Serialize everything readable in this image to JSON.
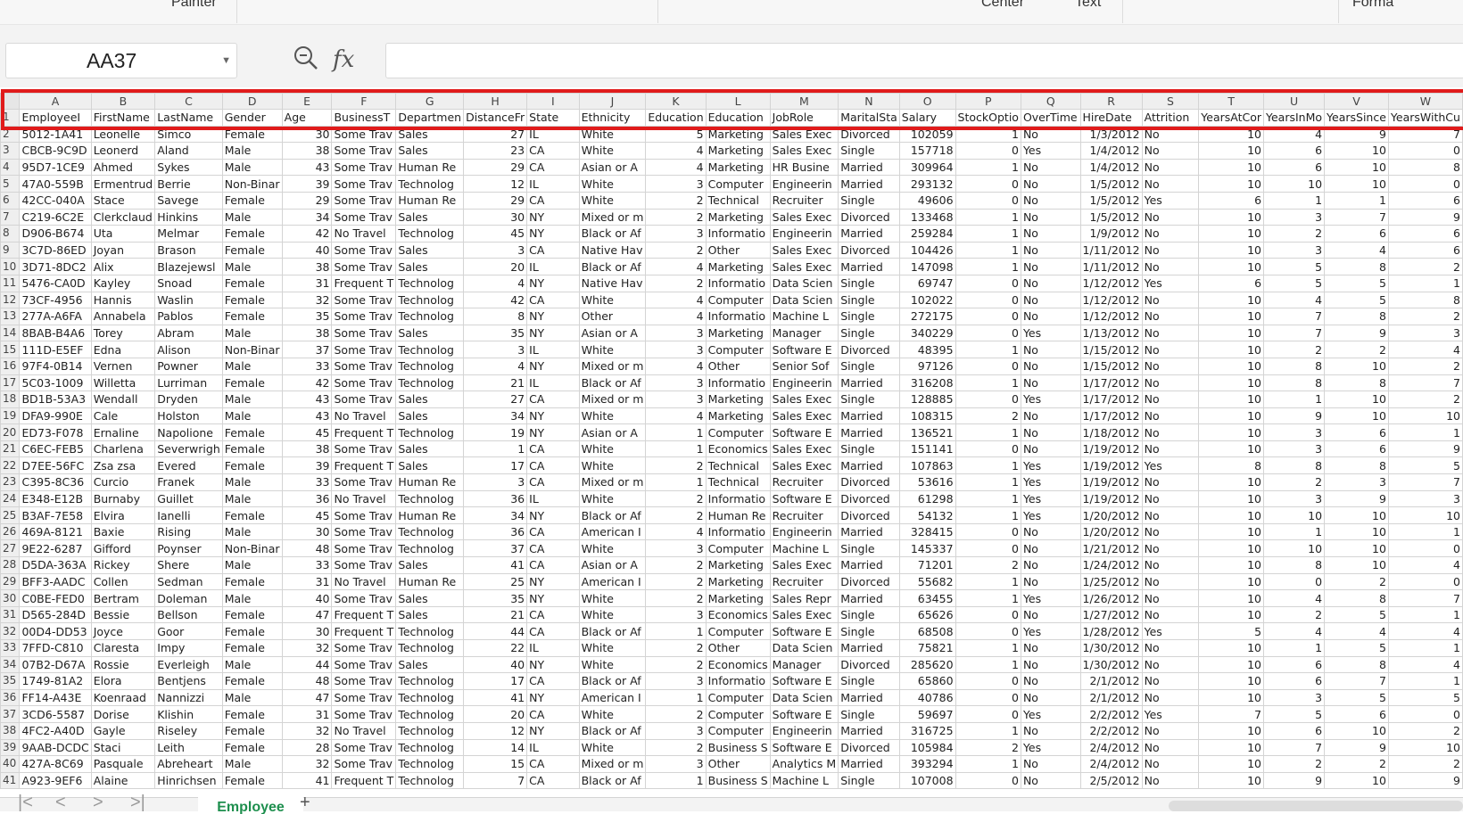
{
  "ribbon": {
    "frag_painter": "Painter",
    "frag_center": "Center",
    "frag_text": "Text",
    "frag_format": "Forma"
  },
  "formula_bar": {
    "name_box": "AA37",
    "zoom_icon": "zoom-icon",
    "fx_label": "fx",
    "formula": ""
  },
  "columns": [
    "A",
    "B",
    "C",
    "D",
    "E",
    "F",
    "G",
    "H",
    "I",
    "J",
    "K",
    "L",
    "M",
    "N",
    "O",
    "P",
    "Q",
    "R",
    "S",
    "T",
    "U",
    "V",
    "W"
  ],
  "header_row": {
    "row": "1",
    "cells": [
      "EmployeeI",
      "FirstName",
      "LastName",
      "Gender",
      "Age",
      "BusinessT",
      "Departmen",
      "DistanceFr",
      "State",
      "Ethnicity",
      "Education",
      "Education",
      "JobRole",
      "MaritalSta",
      "Salary",
      "StockOptio",
      "OverTime",
      "HireDate",
      "Attrition",
      "YearsAtCor",
      "YearsInMo",
      "YearsSince",
      "YearsWithCu"
    ]
  },
  "rows": [
    {
      "row": "2",
      "cells": [
        "5012-1A41",
        "Leonelle",
        "Simco",
        "Female",
        "30",
        "Some Trav",
        "Sales",
        "27",
        "IL",
        "White",
        "5",
        "Marketing",
        "Sales Exec",
        "Divorced",
        "102059",
        "1",
        "No",
        "1/3/2012",
        "No",
        "10",
        "4",
        "9",
        "7"
      ]
    },
    {
      "row": "3",
      "cells": [
        "CBCB-9C9D",
        "Leonerd",
        "Aland",
        "Male",
        "38",
        "Some Trav",
        "Sales",
        "23",
        "CA",
        "White",
        "4",
        "Marketing",
        "Sales Exec",
        "Single",
        "157718",
        "0",
        "Yes",
        "1/4/2012",
        "No",
        "10",
        "6",
        "10",
        "0"
      ]
    },
    {
      "row": "4",
      "cells": [
        "95D7-1CE9",
        "Ahmed",
        "Sykes",
        "Male",
        "43",
        "Some Trav",
        "Human Re",
        "29",
        "CA",
        "Asian or A",
        "4",
        "Marketing",
        "HR Busine",
        "Married",
        "309964",
        "1",
        "No",
        "1/4/2012",
        "No",
        "10",
        "6",
        "10",
        "8"
      ]
    },
    {
      "row": "5",
      "cells": [
        "47A0-559B",
        "Ermentrud",
        "Berrie",
        "Non-Binar",
        "39",
        "Some Trav",
        "Technolog",
        "12",
        "IL",
        "White",
        "3",
        "Computer",
        "Engineerin",
        "Married",
        "293132",
        "0",
        "No",
        "1/5/2012",
        "No",
        "10",
        "10",
        "10",
        "0"
      ]
    },
    {
      "row": "6",
      "cells": [
        "42CC-040A",
        "Stace",
        "Savege",
        "Female",
        "29",
        "Some Trav",
        "Human Re",
        "29",
        "CA",
        "White",
        "2",
        "Technical",
        "Recruiter",
        "Single",
        "49606",
        "0",
        "No",
        "1/5/2012",
        "Yes",
        "6",
        "1",
        "1",
        "6"
      ]
    },
    {
      "row": "7",
      "cells": [
        "C219-6C2E",
        "Clerkclaud",
        "Hinkins",
        "Male",
        "34",
        "Some Trav",
        "Sales",
        "30",
        "NY",
        "Mixed or m",
        "2",
        "Marketing",
        "Sales Exec",
        "Divorced",
        "133468",
        "1",
        "No",
        "1/5/2012",
        "No",
        "10",
        "3",
        "7",
        "9"
      ]
    },
    {
      "row": "8",
      "cells": [
        "D906-B674",
        "Uta",
        "Melmar",
        "Female",
        "42",
        "No Travel",
        "Technolog",
        "45",
        "NY",
        "Black or Af",
        "3",
        "Informatio",
        "Engineerin",
        "Married",
        "259284",
        "1",
        "No",
        "1/9/2012",
        "No",
        "10",
        "2",
        "6",
        "6"
      ]
    },
    {
      "row": "9",
      "cells": [
        "3C7D-86ED",
        "Joyan",
        "Brason",
        "Female",
        "40",
        "Some Trav",
        "Sales",
        "3",
        "CA",
        "Native Hav",
        "2",
        "Other",
        "Sales Exec",
        "Divorced",
        "104426",
        "1",
        "No",
        "1/11/2012",
        "No",
        "10",
        "3",
        "4",
        "6"
      ]
    },
    {
      "row": "10",
      "cells": [
        "3D71-8DC2",
        "Alix",
        "Blazejewsl",
        "Male",
        "38",
        "Some Trav",
        "Sales",
        "20",
        "IL",
        "Black or Af",
        "4",
        "Marketing",
        "Sales Exec",
        "Married",
        "147098",
        "1",
        "No",
        "1/11/2012",
        "No",
        "10",
        "5",
        "8",
        "2"
      ]
    },
    {
      "row": "11",
      "cells": [
        "5476-CA0D",
        "Kayley",
        "Snoad",
        "Female",
        "31",
        "Frequent T",
        "Technolog",
        "4",
        "NY",
        "Native Hav",
        "2",
        "Informatio",
        "Data Scien",
        "Single",
        "69747",
        "0",
        "No",
        "1/12/2012",
        "Yes",
        "6",
        "5",
        "5",
        "1"
      ]
    },
    {
      "row": "12",
      "cells": [
        "73CF-4956",
        "Hannis",
        "Waslin",
        "Female",
        "32",
        "Some Trav",
        "Technolog",
        "42",
        "CA",
        "White",
        "4",
        "Computer",
        "Data Scien",
        "Single",
        "102022",
        "0",
        "No",
        "1/12/2012",
        "No",
        "10",
        "4",
        "5",
        "8"
      ]
    },
    {
      "row": "13",
      "cells": [
        "277A-A6FA",
        "Annabela",
        "Pablos",
        "Female",
        "35",
        "Some Trav",
        "Technolog",
        "8",
        "NY",
        "Other",
        "4",
        "Informatio",
        "Machine L",
        "Single",
        "272175",
        "0",
        "No",
        "1/12/2012",
        "No",
        "10",
        "7",
        "8",
        "2"
      ]
    },
    {
      "row": "14",
      "cells": [
        "8BAB-B4A6",
        "Torey",
        "Abram",
        "Male",
        "38",
        "Some Trav",
        "Sales",
        "35",
        "NY",
        "Asian or A",
        "3",
        "Marketing",
        "Manager",
        "Single",
        "340229",
        "0",
        "Yes",
        "1/13/2012",
        "No",
        "10",
        "7",
        "9",
        "3"
      ]
    },
    {
      "row": "15",
      "cells": [
        "111D-E5EF",
        "Edna",
        "Alison",
        "Non-Binar",
        "37",
        "Some Trav",
        "Technolog",
        "3",
        "IL",
        "White",
        "3",
        "Computer",
        "Software E",
        "Divorced",
        "48395",
        "1",
        "No",
        "1/15/2012",
        "No",
        "10",
        "2",
        "2",
        "4"
      ]
    },
    {
      "row": "16",
      "cells": [
        "97F4-0B14",
        "Vernen",
        "Powner",
        "Male",
        "33",
        "Some Trav",
        "Technolog",
        "4",
        "NY",
        "Mixed or m",
        "4",
        "Other",
        "Senior Sof",
        "Single",
        "97126",
        "0",
        "No",
        "1/15/2012",
        "No",
        "10",
        "8",
        "10",
        "2"
      ]
    },
    {
      "row": "17",
      "cells": [
        "5C03-1009",
        "Willetta",
        "Lurriman",
        "Female",
        "42",
        "Some Trav",
        "Technolog",
        "21",
        "IL",
        "Black or Af",
        "3",
        "Informatio",
        "Engineerin",
        "Married",
        "316208",
        "1",
        "No",
        "1/17/2012",
        "No",
        "10",
        "8",
        "8",
        "7"
      ]
    },
    {
      "row": "18",
      "cells": [
        "BD1B-53A3",
        "Wendall",
        "Dryden",
        "Male",
        "43",
        "Some Trav",
        "Sales",
        "27",
        "CA",
        "Mixed or m",
        "3",
        "Marketing",
        "Sales Exec",
        "Single",
        "128885",
        "0",
        "Yes",
        "1/17/2012",
        "No",
        "10",
        "1",
        "10",
        "2"
      ]
    },
    {
      "row": "19",
      "cells": [
        "DFA9-990E",
        "Cale",
        "Holston",
        "Male",
        "43",
        "No Travel",
        "Sales",
        "34",
        "NY",
        "White",
        "4",
        "Marketing",
        "Sales Exec",
        "Married",
        "108315",
        "2",
        "No",
        "1/17/2012",
        "No",
        "10",
        "9",
        "10",
        "10"
      ]
    },
    {
      "row": "20",
      "cells": [
        "ED73-F078",
        "Ernaline",
        "Napolione",
        "Female",
        "45",
        "Frequent T",
        "Technolog",
        "19",
        "NY",
        "Asian or A",
        "1",
        "Computer",
        "Software E",
        "Married",
        "136521",
        "1",
        "No",
        "1/18/2012",
        "No",
        "10",
        "3",
        "6",
        "1"
      ]
    },
    {
      "row": "21",
      "cells": [
        "C6EC-FEB5",
        "Charlena",
        "Severwrigh",
        "Female",
        "38",
        "Some Trav",
        "Sales",
        "1",
        "CA",
        "White",
        "1",
        "Economics",
        "Sales Exec",
        "Single",
        "151141",
        "0",
        "No",
        "1/19/2012",
        "No",
        "10",
        "3",
        "6",
        "9"
      ]
    },
    {
      "row": "22",
      "cells": [
        "D7EE-56FC",
        "Zsa zsa",
        "Evered",
        "Female",
        "39",
        "Frequent T",
        "Sales",
        "17",
        "CA",
        "White",
        "2",
        "Technical",
        "Sales Exec",
        "Married",
        "107863",
        "1",
        "Yes",
        "1/19/2012",
        "Yes",
        "8",
        "8",
        "8",
        "5"
      ]
    },
    {
      "row": "23",
      "cells": [
        "C395-8C36",
        "Curcio",
        "Franek",
        "Male",
        "33",
        "Some Trav",
        "Human Re",
        "3",
        "CA",
        "Mixed or m",
        "1",
        "Technical",
        "Recruiter",
        "Divorced",
        "53616",
        "1",
        "Yes",
        "1/19/2012",
        "No",
        "10",
        "2",
        "3",
        "7"
      ]
    },
    {
      "row": "24",
      "cells": [
        "E348-E12B",
        "Burnaby",
        "Guillet",
        "Male",
        "36",
        "No Travel",
        "Technolog",
        "36",
        "IL",
        "White",
        "2",
        "Informatio",
        "Software E",
        "Divorced",
        "61298",
        "1",
        "Yes",
        "1/19/2012",
        "No",
        "10",
        "3",
        "9",
        "3"
      ]
    },
    {
      "row": "25",
      "cells": [
        "B3AF-7E58",
        "Elvira",
        "Ianelli",
        "Female",
        "45",
        "Some Trav",
        "Human Re",
        "34",
        "NY",
        "Black or Af",
        "2",
        "Human Re",
        "Recruiter",
        "Divorced",
        "54132",
        "1",
        "Yes",
        "1/20/2012",
        "No",
        "10",
        "10",
        "10",
        "10"
      ]
    },
    {
      "row": "26",
      "cells": [
        "469A-8121",
        "Baxie",
        "Rising",
        "Male",
        "30",
        "Some Trav",
        "Technolog",
        "36",
        "CA",
        "American I",
        "4",
        "Informatio",
        "Engineerin",
        "Married",
        "328415",
        "0",
        "No",
        "1/20/2012",
        "No",
        "10",
        "1",
        "10",
        "1"
      ]
    },
    {
      "row": "27",
      "cells": [
        "9E22-6287",
        "Gifford",
        "Poynser",
        "Non-Binar",
        "48",
        "Some Trav",
        "Technolog",
        "37",
        "CA",
        "White",
        "3",
        "Computer",
        "Machine L",
        "Single",
        "145337",
        "0",
        "No",
        "1/21/2012",
        "No",
        "10",
        "10",
        "10",
        "0"
      ]
    },
    {
      "row": "28",
      "cells": [
        "D5DA-363A",
        "Rickey",
        "Shere",
        "Male",
        "33",
        "Some Trav",
        "Sales",
        "41",
        "CA",
        "Asian or A",
        "2",
        "Marketing",
        "Sales Exec",
        "Married",
        "71201",
        "2",
        "No",
        "1/24/2012",
        "No",
        "10",
        "8",
        "10",
        "4"
      ]
    },
    {
      "row": "29",
      "cells": [
        "BFF3-AADC",
        "Collen",
        "Sedman",
        "Female",
        "31",
        "No Travel",
        "Human Re",
        "25",
        "NY",
        "American I",
        "2",
        "Marketing",
        "Recruiter",
        "Divorced",
        "55682",
        "1",
        "No",
        "1/25/2012",
        "No",
        "10",
        "0",
        "2",
        "0"
      ]
    },
    {
      "row": "30",
      "cells": [
        "C0BE-FED0",
        "Bertram",
        "Doleman",
        "Male",
        "40",
        "Some Trav",
        "Sales",
        "35",
        "NY",
        "White",
        "2",
        "Marketing",
        "Sales Repr",
        "Married",
        "63455",
        "1",
        "Yes",
        "1/26/2012",
        "No",
        "10",
        "4",
        "8",
        "7"
      ]
    },
    {
      "row": "31",
      "cells": [
        "D565-284D",
        "Bessie",
        "Bellson",
        "Female",
        "47",
        "Frequent T",
        "Sales",
        "21",
        "CA",
        "White",
        "3",
        "Economics",
        "Sales Exec",
        "Single",
        "65626",
        "0",
        "No",
        "1/27/2012",
        "No",
        "10",
        "2",
        "5",
        "1"
      ]
    },
    {
      "row": "32",
      "cells": [
        "00D4-DD53",
        "Joyce",
        "Goor",
        "Female",
        "30",
        "Frequent T",
        "Technolog",
        "44",
        "CA",
        "Black or Af",
        "1",
        "Computer",
        "Software E",
        "Single",
        "68508",
        "0",
        "Yes",
        "1/28/2012",
        "Yes",
        "5",
        "4",
        "4",
        "4"
      ]
    },
    {
      "row": "33",
      "cells": [
        "7FFD-C810",
        "Claresta",
        "Impy",
        "Female",
        "32",
        "Some Trav",
        "Technolog",
        "22",
        "IL",
        "White",
        "2",
        "Other",
        "Data Scien",
        "Married",
        "75821",
        "1",
        "No",
        "1/30/2012",
        "No",
        "10",
        "1",
        "5",
        "1"
      ]
    },
    {
      "row": "34",
      "cells": [
        "07B2-D67A",
        "Rossie",
        "Everleigh",
        "Male",
        "44",
        "Some Trav",
        "Sales",
        "40",
        "NY",
        "White",
        "2",
        "Economics",
        "Manager",
        "Divorced",
        "285620",
        "1",
        "No",
        "1/30/2012",
        "No",
        "10",
        "6",
        "8",
        "4"
      ]
    },
    {
      "row": "35",
      "cells": [
        "1749-81A2",
        "Elora",
        "Bentjens",
        "Female",
        "48",
        "Some Trav",
        "Technolog",
        "17",
        "CA",
        "Black or Af",
        "3",
        "Informatio",
        "Software E",
        "Single",
        "65860",
        "0",
        "No",
        "2/1/2012",
        "No",
        "10",
        "6",
        "7",
        "1"
      ]
    },
    {
      "row": "36",
      "cells": [
        "FF14-A43E",
        "Koenraad",
        "Nannizzi",
        "Male",
        "47",
        "Some Trav",
        "Technolog",
        "41",
        "NY",
        "American I",
        "1",
        "Computer",
        "Data Scien",
        "Married",
        "40786",
        "0",
        "No",
        "2/1/2012",
        "No",
        "10",
        "3",
        "5",
        "5"
      ]
    },
    {
      "row": "37",
      "cells": [
        "3CD6-5587",
        "Dorise",
        "Klishin",
        "Female",
        "31",
        "Some Trav",
        "Technolog",
        "20",
        "CA",
        "White",
        "2",
        "Computer",
        "Software E",
        "Single",
        "59697",
        "0",
        "Yes",
        "2/2/2012",
        "Yes",
        "7",
        "5",
        "6",
        "0"
      ]
    },
    {
      "row": "38",
      "cells": [
        "4FC2-A40D",
        "Gayle",
        "Riseley",
        "Female",
        "32",
        "No Travel",
        "Technolog",
        "12",
        "NY",
        "Black or Af",
        "3",
        "Computer",
        "Engineerin",
        "Married",
        "316725",
        "1",
        "No",
        "2/2/2012",
        "No",
        "10",
        "6",
        "10",
        "2"
      ]
    },
    {
      "row": "39",
      "cells": [
        "9AAB-DCDC",
        "Staci",
        "Leith",
        "Female",
        "28",
        "Some Trav",
        "Technolog",
        "14",
        "IL",
        "White",
        "2",
        "Business S",
        "Software E",
        "Divorced",
        "105984",
        "2",
        "Yes",
        "2/4/2012",
        "No",
        "10",
        "7",
        "9",
        "10"
      ]
    },
    {
      "row": "40",
      "cells": [
        "427A-8C69",
        "Pasquale",
        "Abreheart",
        "Male",
        "32",
        "Some Trav",
        "Technolog",
        "15",
        "CA",
        "Mixed or m",
        "3",
        "Other",
        "Analytics M",
        "Married",
        "393294",
        "1",
        "No",
        "2/4/2012",
        "No",
        "10",
        "2",
        "2",
        "2"
      ]
    },
    {
      "row": "41",
      "cells": [
        "A923-9EF6",
        "Alaine",
        "Hinrichsen",
        "Female",
        "41",
        "Frequent T",
        "Technolog",
        "7",
        "CA",
        "Black or Af",
        "1",
        "Business S",
        "Machine L",
        "Single",
        "107008",
        "0",
        "No",
        "2/5/2012",
        "No",
        "10",
        "9",
        "10",
        "9"
      ]
    }
  ],
  "sheet_tabs": [
    "Employee"
  ],
  "colors": {
    "highlight": "#e01b1b",
    "tab_text": "#1e8f4e"
  }
}
